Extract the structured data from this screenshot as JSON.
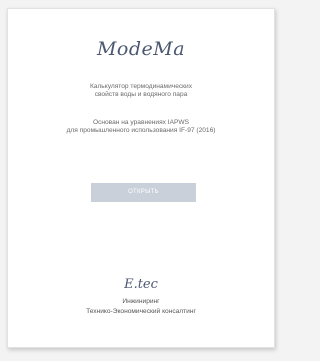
{
  "app": {
    "logo_text": "ModeMa",
    "description_line1": "Калькулятор термодинамических",
    "description_line2": "свойств воды и водяного пара",
    "basis_line1": "Основан на уравнениях IAPWS",
    "basis_line2": "для промышленного использования IF-97 (2016)"
  },
  "actions": {
    "open_label": "ОТКРЫТЬ"
  },
  "footer": {
    "company_logo": "E.tec",
    "line1": "Инжиниринг",
    "line2": "Технико-Экономический консалтинг"
  },
  "colors": {
    "logo": "#4b5870",
    "button_bg": "#c9d0da",
    "button_text": "#ffffff",
    "text": "#6a6a6a"
  }
}
